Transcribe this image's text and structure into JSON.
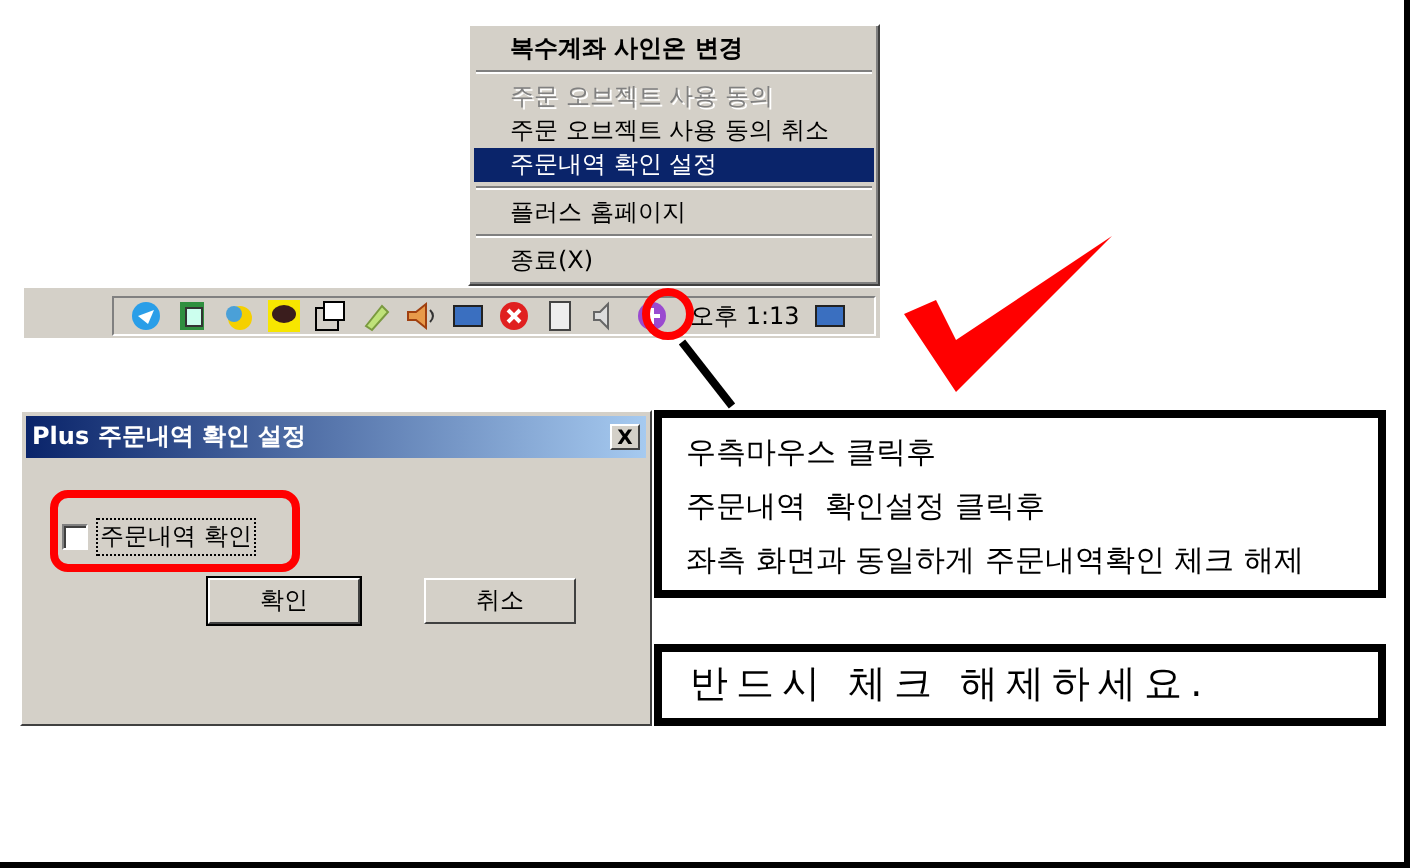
{
  "context_menu": {
    "items": [
      {
        "kind": "header",
        "label": "복수계좌 사인온 변경",
        "disabled": false,
        "selected": false
      },
      {
        "kind": "separator"
      },
      {
        "kind": "item",
        "label": "주문 오브젝트 사용 동의",
        "disabled": true,
        "selected": false
      },
      {
        "kind": "item",
        "label": "주문 오브젝트 사용 동의 취소",
        "disabled": false,
        "selected": false
      },
      {
        "kind": "item",
        "label": "주문내역 확인 설정",
        "disabled": false,
        "selected": true
      },
      {
        "kind": "separator"
      },
      {
        "kind": "item",
        "label": "플러스 홈페이지",
        "disabled": false,
        "selected": false
      },
      {
        "kind": "separator"
      },
      {
        "kind": "item",
        "label": "종료(X)",
        "disabled": false,
        "selected": false
      }
    ]
  },
  "taskbar": {
    "clock": "오후 1:13"
  },
  "dialog": {
    "title": "Plus 주문내역 확인 설정",
    "close": "X",
    "checkbox": {
      "label": "주문내역 확인",
      "checked": false
    },
    "buttons": [
      "확인",
      "취소"
    ]
  },
  "instructions": [
    "우측마우스 클릭후",
    "주문내역  확인설정 클릭후",
    "좌측 화면과 동일하게 주문내역확인 체크 해제"
  ],
  "warning": "반드시  체크  해제하세요."
}
